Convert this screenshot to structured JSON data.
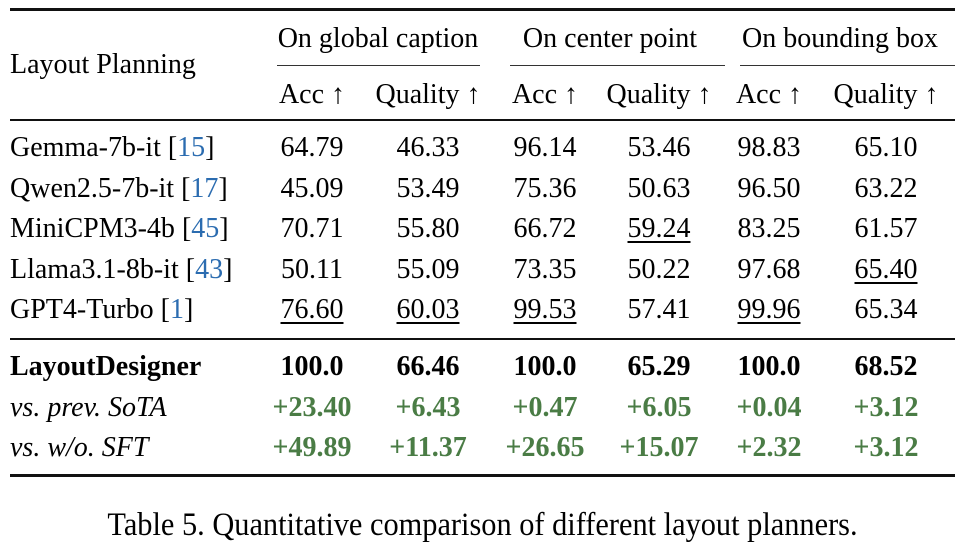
{
  "table": {
    "corner_header": "Layout Planning",
    "groups": [
      {
        "label": "On global caption"
      },
      {
        "label": "On center point"
      },
      {
        "label": "On bounding box"
      }
    ],
    "subheaders": [
      "Acc ↑",
      "Quality ↑",
      "Acc ↑",
      "Quality ↑",
      "Acc ↑",
      "Quality ↑"
    ],
    "baseline_rows": [
      {
        "name": "Gemma-7b-it",
        "cite": "15",
        "values": [
          "64.79",
          "46.33",
          "96.14",
          "53.46",
          "98.83",
          "65.10"
        ],
        "underlined": [
          false,
          false,
          false,
          false,
          false,
          false
        ]
      },
      {
        "name": "Qwen2.5-7b-it",
        "cite": "17",
        "values": [
          "45.09",
          "53.49",
          "75.36",
          "50.63",
          "96.50",
          "63.22"
        ],
        "underlined": [
          false,
          false,
          false,
          false,
          false,
          false
        ]
      },
      {
        "name": "MiniCPM3-4b",
        "cite": "45",
        "values": [
          "70.71",
          "55.80",
          "66.72",
          "59.24",
          "83.25",
          "61.57"
        ],
        "underlined": [
          false,
          false,
          false,
          true,
          false,
          false
        ]
      },
      {
        "name": "Llama3.1-8b-it",
        "cite": "43",
        "values": [
          "50.11",
          "55.09",
          "73.35",
          "50.22",
          "97.68",
          "65.40"
        ],
        "underlined": [
          false,
          false,
          false,
          false,
          false,
          true
        ]
      },
      {
        "name": "GPT4-Turbo",
        "cite": "1",
        "values": [
          "76.60",
          "60.03",
          "99.53",
          "57.41",
          "99.96",
          "65.34"
        ],
        "underlined": [
          true,
          true,
          true,
          false,
          true,
          false
        ]
      }
    ],
    "ours_row": {
      "name": "LayoutDesigner",
      "values": [
        "100.0",
        "66.46",
        "100.0",
        "65.29",
        "100.0",
        "68.52"
      ]
    },
    "delta_rows": [
      {
        "name": "vs. prev. SoTA",
        "values": [
          "+23.40",
          "+6.43",
          "+0.47",
          "+6.05",
          "+0.04",
          "+3.12"
        ]
      },
      {
        "name": "vs. w/o. SFT",
        "values": [
          "+49.89",
          "+11.37",
          "+26.65",
          "+15.07",
          "+2.32",
          "+3.12"
        ]
      }
    ]
  },
  "caption": "Table 5. Quantitative comparison of different layout planners.",
  "colors": {
    "citation": "#2b6cb0",
    "improvement": "#4a7c45"
  }
}
